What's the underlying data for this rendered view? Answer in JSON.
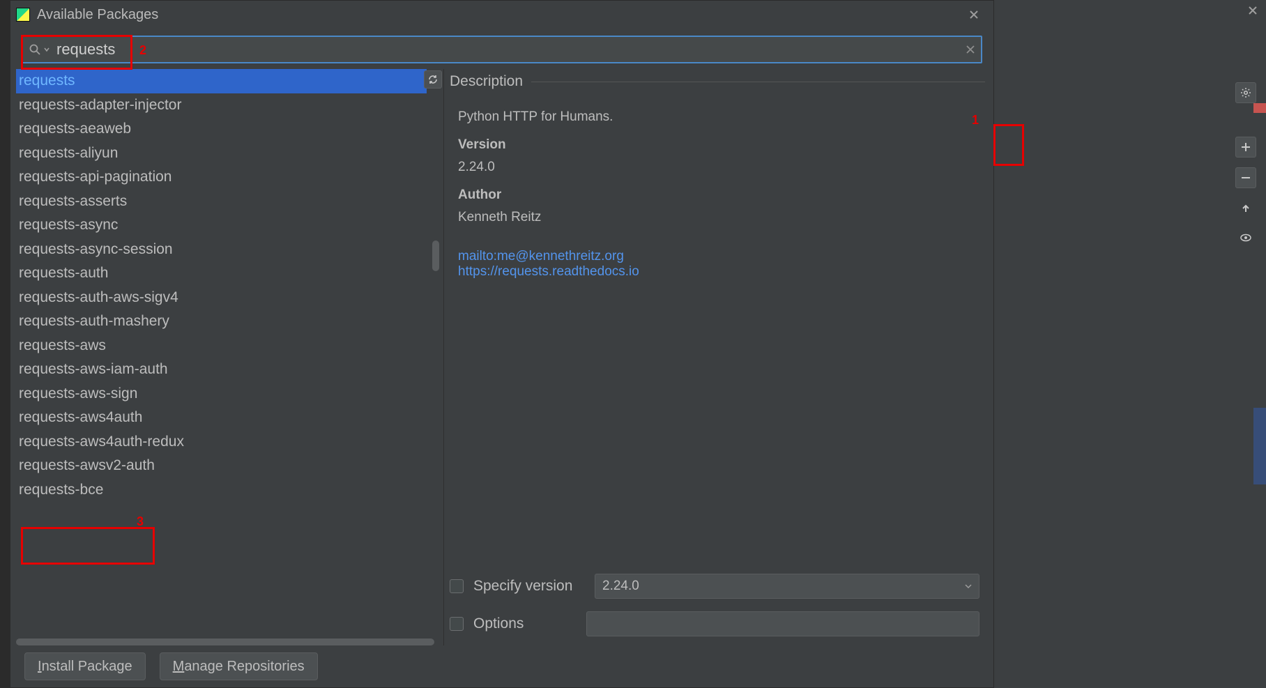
{
  "title": "Available Packages",
  "search": {
    "value": "requests"
  },
  "packages": [
    "requests",
    "requests-adapter-injector",
    "requests-aeaweb",
    "requests-aliyun",
    "requests-api-pagination",
    "requests-asserts",
    "requests-async",
    "requests-async-session",
    "requests-auth",
    "requests-auth-aws-sigv4",
    "requests-auth-mashery",
    "requests-aws",
    "requests-aws-iam-auth",
    "requests-aws-sign",
    "requests-aws4auth",
    "requests-aws4auth-redux",
    "requests-awsv2-auth",
    "requests-bce"
  ],
  "selected_index": 0,
  "description": {
    "header": "Description",
    "summary": "Python HTTP for Humans.",
    "version_label": "Version",
    "version": "2.24.0",
    "author_label": "Author",
    "author": "Kenneth Reitz",
    "mailto": "mailto:me@kennethreitz.org",
    "homepage": "https://requests.readthedocs.io"
  },
  "controls": {
    "specify_version_label": "Specify version",
    "specify_version_value": "2.24.0",
    "options_label": "Options"
  },
  "footer": {
    "install_label_pre": "I",
    "install_label_rest": "nstall Package",
    "manage_label_pre": "M",
    "manage_label_rest": "anage Repositories"
  },
  "annotations": {
    "a1": "1",
    "a2": "2",
    "a3": "3"
  }
}
